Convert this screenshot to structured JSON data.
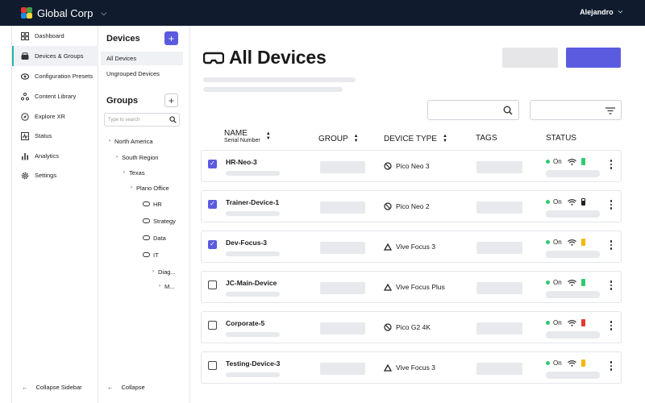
{
  "header": {
    "org_name": "Global Corp",
    "user_name": "Alejandro",
    "logo_colors": [
      "#e53935",
      "#43a047",
      "#1e88e5",
      "#fdd835"
    ]
  },
  "sidebar": {
    "accent": "#1fb8a8",
    "items": [
      {
        "label": "Dashboard",
        "icon": "dashboard-icon",
        "active": false
      },
      {
        "label": "Devices & Groups",
        "icon": "devices-icon",
        "active": true
      },
      {
        "label": "Configuration Presets",
        "icon": "presets-icon",
        "active": false
      },
      {
        "label": "Content Library",
        "icon": "content-library-icon",
        "active": false
      },
      {
        "label": "Explore XR",
        "icon": "explore-icon",
        "active": false
      },
      {
        "label": "Status",
        "icon": "status-icon",
        "active": false
      },
      {
        "label": "Analytics",
        "icon": "analytics-icon",
        "active": false
      },
      {
        "label": "Settings",
        "icon": "gear-icon",
        "active": false
      }
    ],
    "collapse_label": "Collapse Sidebar"
  },
  "tree": {
    "devices_heading": "Devices",
    "device_links": [
      "All Devices",
      "Ungrouped Devices"
    ],
    "groups_heading": "Groups",
    "search_placeholder": "Type to search",
    "nodes": [
      "North America",
      "South Region",
      "Texas",
      "Plano Office",
      "HR",
      "Strategy",
      "Data",
      "IT",
      "Diag...",
      "M..."
    ],
    "collapse_label": "Collapse"
  },
  "main": {
    "title": "All Devices",
    "primary_color": "#5b5be0",
    "columns": {
      "name": "NAME",
      "name_sub": "Serial Number",
      "group": "GROUP",
      "device_type": "DEVICE TYPE",
      "tags": "TAGS",
      "status": "STATUS"
    },
    "rows": [
      {
        "name": "HR-Neo-3",
        "checked": true,
        "type": "Pico Neo 3",
        "brand": "pico",
        "status": "On",
        "battery": "#2ecc71",
        "battery_level": 0.9
      },
      {
        "name": "Trainer-Device-1",
        "checked": true,
        "type": "Pico Neo 2",
        "brand": "pico",
        "status": "On",
        "battery": "charging",
        "battery_level": 0.6
      },
      {
        "name": "Dev-Focus-3",
        "checked": true,
        "type": "Vive Focus 3",
        "brand": "vive",
        "status": "On",
        "battery": "#f5b800",
        "battery_level": 0.5
      },
      {
        "name": "JC-Main-Device",
        "checked": false,
        "type": "Vive Focus Plus",
        "brand": "vive",
        "status": "On",
        "battery": "#2ecc71",
        "battery_level": 0.9
      },
      {
        "name": "Corporate-5",
        "checked": false,
        "type": "Pico G2 4K",
        "brand": "pico",
        "status": "On",
        "battery": "#e53935",
        "battery_level": 0.1
      },
      {
        "name": "Testing-Device-3",
        "checked": false,
        "type": "Vive Focus 3",
        "brand": "vive",
        "status": "On",
        "battery": "#f5b800",
        "battery_level": 0.5
      }
    ]
  }
}
